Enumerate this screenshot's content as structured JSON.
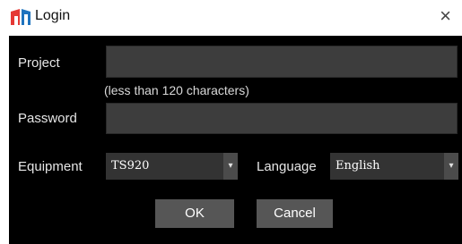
{
  "window": {
    "title": "Login",
    "close_glyph": "×",
    "icon": "app-logo-icon"
  },
  "form": {
    "project_label": "Project",
    "project_value": "",
    "project_hint": "(less than 120 characters)",
    "password_label": "Password",
    "password_value": "",
    "equipment_label": "Equipment",
    "equipment_value": "TS920",
    "language_label": "Language",
    "language_value": "English",
    "dropdown_glyph": "▾"
  },
  "buttons": {
    "ok_label": "OK",
    "cancel_label": "Cancel"
  },
  "colors": {
    "panel_bg": "#000000",
    "field_bg": "#3d3d3d",
    "button_bg": "#565656"
  }
}
